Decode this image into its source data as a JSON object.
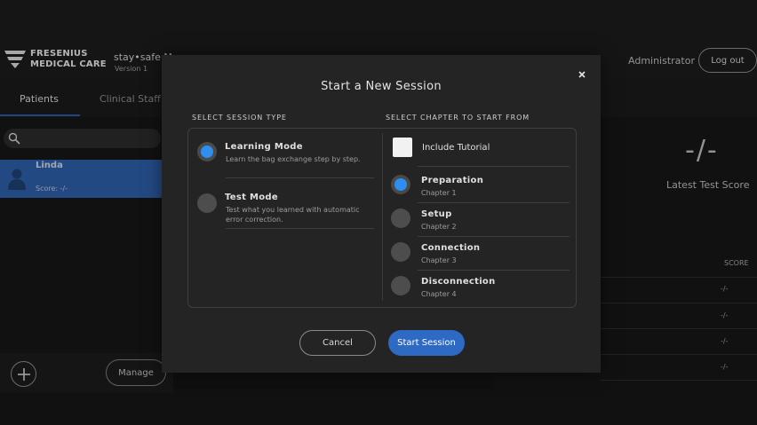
{
  "header": {
    "brand_line1": "FRESENIUS",
    "brand_line2": "MEDICAL CARE",
    "app_name": "stay•safe M",
    "version": "Version 1",
    "user": "Administrator",
    "logout_label": "Log out"
  },
  "tabs": [
    {
      "label": "Patients",
      "active": true
    },
    {
      "label": "Clinical Staff",
      "active": false
    }
  ],
  "search": {
    "placeholder": ""
  },
  "patients": [
    {
      "name": "Linda",
      "score": "Score: -/-",
      "selected": true
    }
  ],
  "sidebar_footer": {
    "manage_label": "Manage"
  },
  "score_panel": {
    "value": "-/-",
    "label": "Latest Test Score",
    "column_header": "SCORE",
    "rows": [
      "-/-",
      "-/-",
      "-/-",
      "-/-"
    ]
  },
  "modal": {
    "title": "Start a New Session",
    "session_type_label": "SELECT SESSION TYPE",
    "chapter_label": "SELECT CHAPTER TO START FROM",
    "session_types": [
      {
        "title": "Learning Mode",
        "description": "Learn the bag exchange step by step.",
        "selected": true
      },
      {
        "title": "Test Mode",
        "description": "Test what you learned with automatic error correction.",
        "selected": false
      }
    ],
    "include_tutorial_label": "Include Tutorial",
    "chapters": [
      {
        "title": "Preparation",
        "subtitle": "Chapter 1",
        "selected": true
      },
      {
        "title": "Setup",
        "subtitle": "Chapter 2",
        "selected": false
      },
      {
        "title": "Connection",
        "subtitle": "Chapter 3",
        "selected": false
      },
      {
        "title": "Disconnection",
        "subtitle": "Chapter 4",
        "selected": false
      }
    ],
    "cancel_label": "Cancel",
    "start_label": "Start Session"
  },
  "colors": {
    "accent": "#2e6ac4",
    "radio_selected": "#2f8ff0",
    "selected_row": "#2e5ea8",
    "modal_bg": "#242424"
  }
}
